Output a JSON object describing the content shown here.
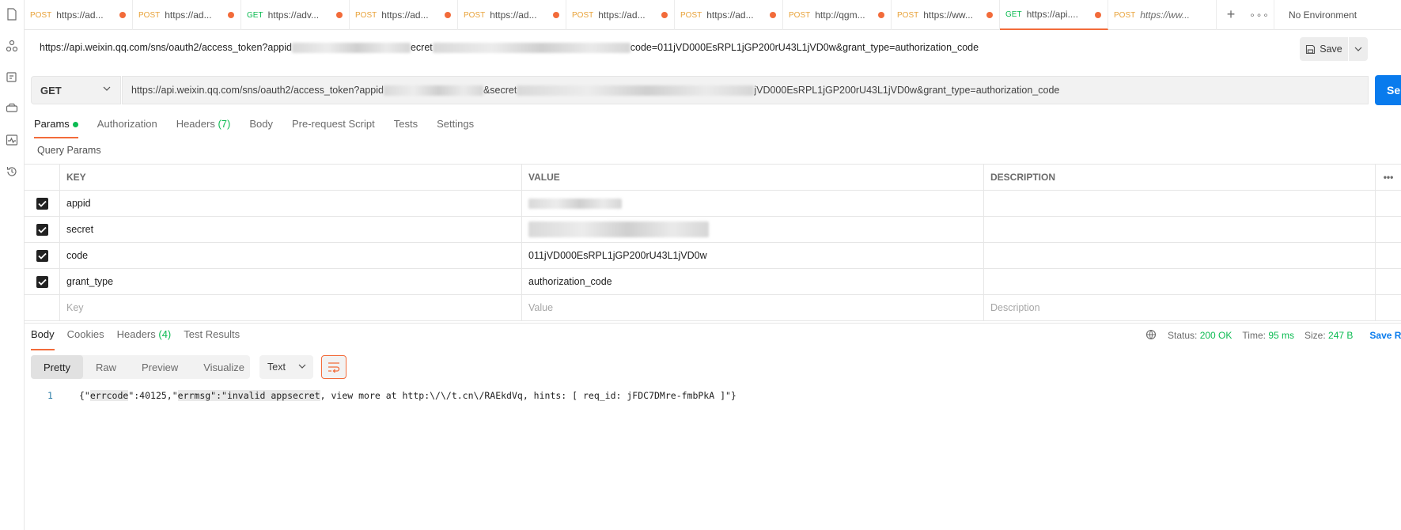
{
  "rail": {
    "icons": [
      "collections-icon",
      "apis-icon",
      "environments-icon",
      "mock-servers-icon",
      "monitors-icon",
      "history-icon"
    ]
  },
  "tabs": [
    {
      "method": "POST",
      "url": "https://ad...",
      "unsaved": true
    },
    {
      "method": "POST",
      "url": "https://ad...",
      "unsaved": true
    },
    {
      "method": "GET",
      "url": "https://adv...",
      "unsaved": true
    },
    {
      "method": "POST",
      "url": "https://ad...",
      "unsaved": true
    },
    {
      "method": "POST",
      "url": "https://ad...",
      "unsaved": true
    },
    {
      "method": "POST",
      "url": "https://ad...",
      "unsaved": true
    },
    {
      "method": "POST",
      "url": "https://ad...",
      "unsaved": true
    },
    {
      "method": "POST",
      "url": "http://qgm...",
      "unsaved": true
    },
    {
      "method": "POST",
      "url": "https://ww...",
      "unsaved": true
    },
    {
      "method": "GET",
      "url": "https://api....",
      "unsaved": true,
      "active": true
    },
    {
      "method": "POST",
      "url": "https://ww...",
      "unsaved": false,
      "italic": true
    }
  ],
  "environment": "No Environment",
  "title": {
    "url_start": "https://api.weixin.qq.com/sns/oauth2/access_token?appid",
    "url_mid": "ecret",
    "url_end": "code=011jVD000EsRPL1jGP200rU43L1jVD0w&grant_type=authorization_code"
  },
  "save_label": "Save",
  "request": {
    "method": "GET",
    "url_start": "https://api.weixin.qq.com/sns/oauth2/access_token?appid",
    "url_mid": "&secret",
    "url_end": "jVD000EsRPL1jGP200rU43L1jVD0w&grant_type=authorization_code",
    "send_label": "Se"
  },
  "request_tabs": {
    "params": "Params",
    "authorization": "Authorization",
    "headers": "Headers",
    "headers_count": "(7)",
    "body": "Body",
    "prerequest": "Pre-request Script",
    "tests": "Tests",
    "settings": "Settings"
  },
  "query_params_label": "Query Params",
  "params_table": {
    "headers": {
      "key": "KEY",
      "value": "VALUE",
      "description": "DESCRIPTION"
    },
    "rows": [
      {
        "key": "appid",
        "value": "",
        "value_hidden": true,
        "checked": true
      },
      {
        "key": "secret",
        "value": "",
        "value_hidden": true,
        "checked": true
      },
      {
        "key": "code",
        "value": "011jVD000EsRPL1jGP200rU43L1jVD0w",
        "checked": true
      },
      {
        "key": "grant_type",
        "value": "authorization_code",
        "checked": true
      }
    ],
    "placeholders": {
      "key": "Key",
      "value": "Value",
      "description": "Description"
    }
  },
  "response": {
    "tabs": {
      "body": "Body",
      "cookies": "Cookies",
      "headers": "Headers",
      "headers_count": "(4)",
      "test_results": "Test Results"
    },
    "status_label": "Status:",
    "status": "200 OK",
    "time_label": "Time:",
    "time": "95 ms",
    "size_label": "Size:",
    "size": "247 B",
    "save_response": "Save Re",
    "views": {
      "pretty": "Pretty",
      "raw": "Raw",
      "preview": "Preview",
      "visualize": "Visualize"
    },
    "format": "Text",
    "line_number": "1",
    "body_part1": "{\"",
    "body_hl1": "errcode",
    "body_part2": "\":40125,\"",
    "body_hl2": "errmsg\":\"invalid appsecret",
    "body_part3": ", view more at http:\\/\\/t.cn\\/RAEkdVq, hints: [ req_id: jFDC7DMre-fmbPkA ]\"}"
  },
  "colors": {
    "accent": "#f26b3a",
    "post": "#e8a33b",
    "get": "#0cbb52",
    "send": "#097bed"
  }
}
